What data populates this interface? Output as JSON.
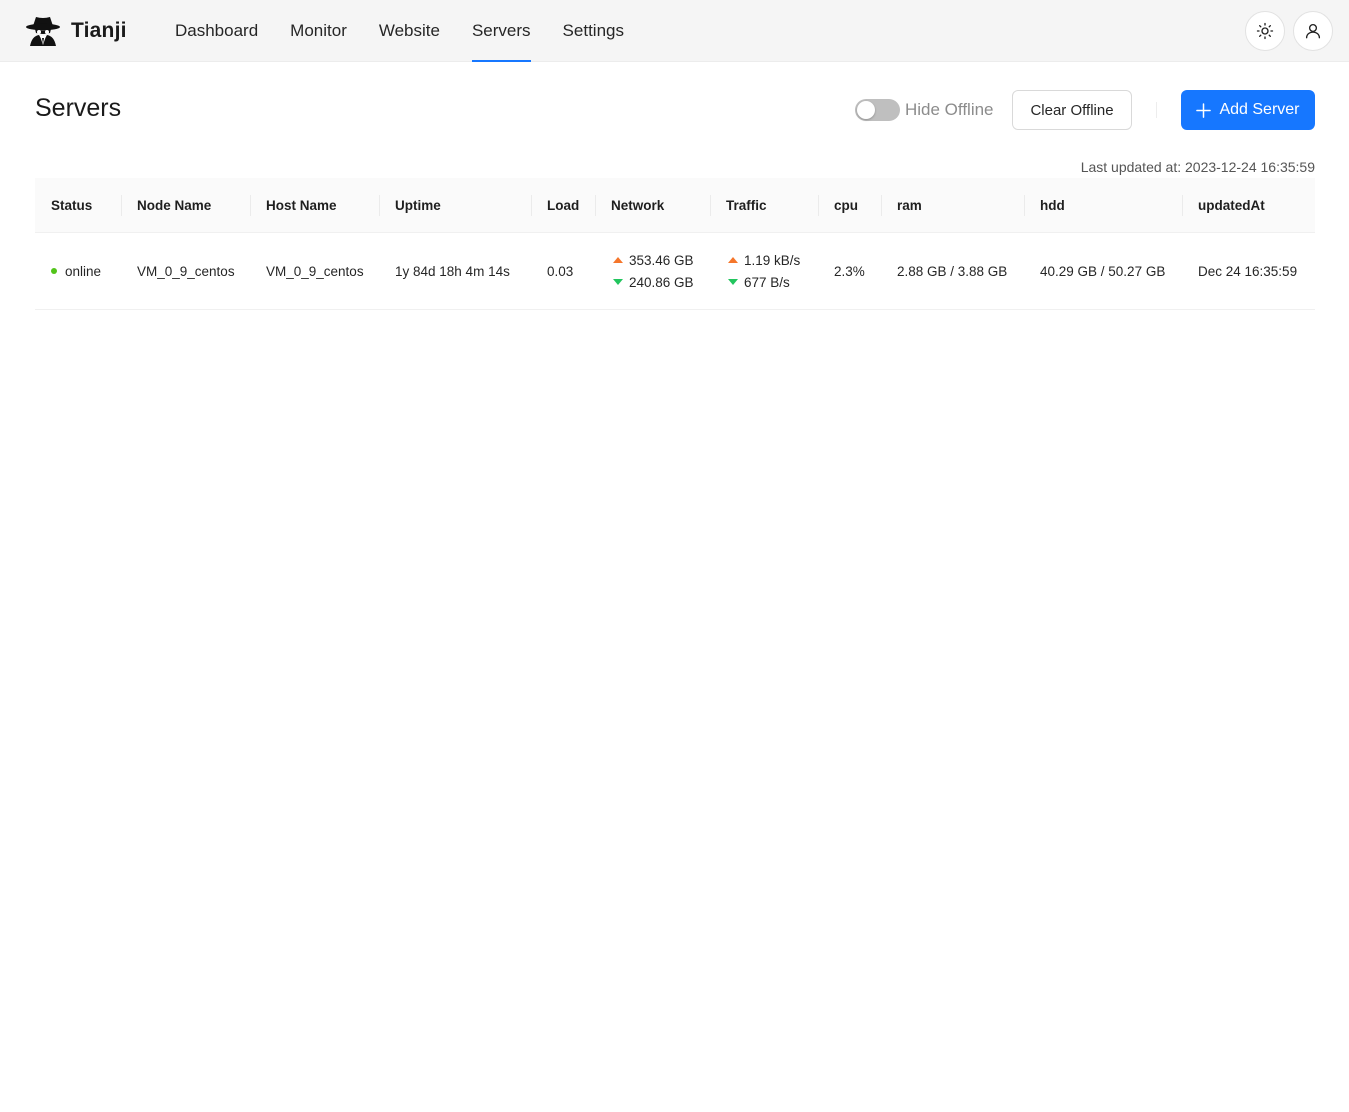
{
  "app": {
    "name": "Tianji",
    "logo_icon": "detective-hat-icon"
  },
  "nav": {
    "items": [
      {
        "label": "Dashboard",
        "active": false
      },
      {
        "label": "Monitor",
        "active": false
      },
      {
        "label": "Website",
        "active": false
      },
      {
        "label": "Servers",
        "active": true
      },
      {
        "label": "Settings",
        "active": false
      }
    ],
    "theme_icon": "sun-icon",
    "user_icon": "user-icon"
  },
  "page": {
    "title": "Servers",
    "hide_offline_label": "Hide Offline",
    "hide_offline_enabled": false,
    "clear_offline_label": "Clear Offline",
    "add_server_label": "Add Server",
    "last_updated": "Last updated at: 2023-12-24 16:35:59"
  },
  "colors": {
    "accent": "#1677ff",
    "online": "#52c41a",
    "up_arrow": "#f5762b",
    "down_arrow": "#22c55e"
  },
  "table": {
    "columns": [
      "Status",
      "Node Name",
      "Host Name",
      "Uptime",
      "Load",
      "Network",
      "Traffic",
      "cpu",
      "ram",
      "hdd",
      "updatedAt"
    ],
    "rows": [
      {
        "status": "online",
        "node_name": "VM_0_9_centos",
        "host_name": "VM_0_9_centos",
        "uptime": "1y 84d 18h 4m 14s",
        "load": "0.03",
        "network_up": "353.46 GB",
        "network_down": "240.86 GB",
        "traffic_up": "1.19 kB/s",
        "traffic_down": "677 B/s",
        "cpu": "2.3%",
        "ram": "2.88 GB / 3.88 GB",
        "hdd": "40.29 GB / 50.27 GB",
        "updated_at": "Dec 24 16:35:59"
      }
    ]
  }
}
